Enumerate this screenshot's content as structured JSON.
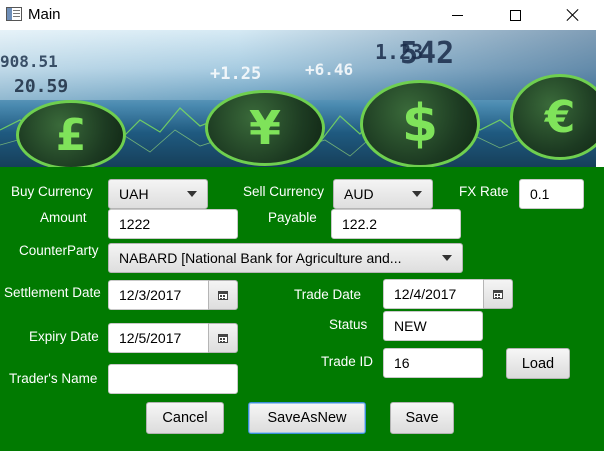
{
  "window": {
    "title": "Main"
  },
  "form": {
    "buy_currency": {
      "label": "Buy Currency",
      "value": "UAH"
    },
    "sell_currency": {
      "label": "Sell Currency",
      "value": "AUD"
    },
    "fx_rate": {
      "label": "FX Rate",
      "value": "0.1"
    },
    "amount": {
      "label": "Amount",
      "value": "1222"
    },
    "payable": {
      "label": "Payable",
      "value": "122.2"
    },
    "counterparty": {
      "label": "CounterParty",
      "value": "NABARD [National Bank for Agriculture and..."
    },
    "settlement_date": {
      "label": "Settlement Date",
      "value": "12/3/2017"
    },
    "trade_date": {
      "label": "Trade Date",
      "value": "12/4/2017"
    },
    "expiry_date": {
      "label": "Expiry Date",
      "value": "12/5/2017"
    },
    "status": {
      "label": "Status",
      "value": "NEW"
    },
    "trade_id": {
      "label": "Trade ID",
      "value": "16"
    },
    "traders_name": {
      "label": "Trader's Name",
      "value": ""
    }
  },
  "buttons": {
    "load": "Load",
    "cancel": "Cancel",
    "save_as_new": "SaveAsNew",
    "save": "Save"
  },
  "banner": {
    "numbers": [
      "908.51",
      "20.59",
      "+1.25",
      "+6.46",
      "542",
      "1.23"
    ],
    "coins": [
      "£",
      "¥",
      "$",
      "€"
    ]
  },
  "colors": {
    "form_background": "#017a01",
    "focus_border": "#3c8ed8"
  }
}
